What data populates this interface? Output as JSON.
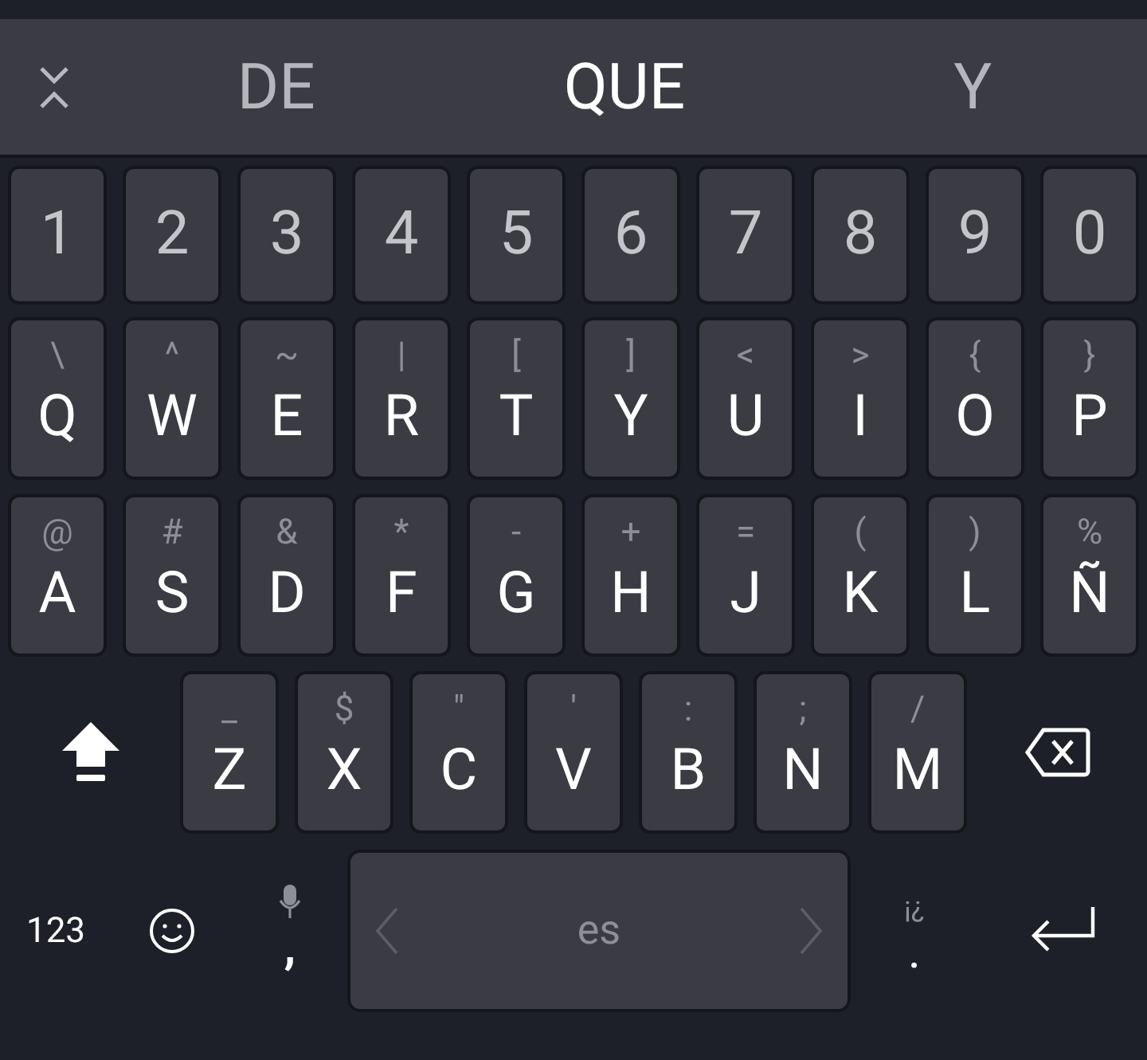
{
  "suggestions": [
    {
      "text": "DE",
      "selected": false
    },
    {
      "text": "QUE",
      "selected": true
    },
    {
      "text": "Y",
      "selected": false
    }
  ],
  "number_row": [
    "1",
    "2",
    "3",
    "4",
    "5",
    "6",
    "7",
    "8",
    "9",
    "0"
  ],
  "letter_rows": [
    [
      {
        "hint": "\\",
        "label": "Q"
      },
      {
        "hint": "^",
        "label": "W"
      },
      {
        "hint": "~",
        "label": "E"
      },
      {
        "hint": "|",
        "label": "R"
      },
      {
        "hint": "[",
        "label": "T"
      },
      {
        "hint": "]",
        "label": "Y"
      },
      {
        "hint": "<",
        "label": "U"
      },
      {
        "hint": ">",
        "label": "I"
      },
      {
        "hint": "{",
        "label": "O"
      },
      {
        "hint": "}",
        "label": "P"
      }
    ],
    [
      {
        "hint": "@",
        "label": "A"
      },
      {
        "hint": "#",
        "label": "S"
      },
      {
        "hint": "&",
        "label": "D"
      },
      {
        "hint": "*",
        "label": "F"
      },
      {
        "hint": "-",
        "label": "G"
      },
      {
        "hint": "+",
        "label": "H"
      },
      {
        "hint": "=",
        "label": "J"
      },
      {
        "hint": "(",
        "label": "K"
      },
      {
        "hint": ")",
        "label": "L"
      },
      {
        "hint": "%",
        "label": "Ñ"
      }
    ],
    [
      {
        "hint": "_",
        "label": "Z"
      },
      {
        "hint": "$",
        "label": "X"
      },
      {
        "hint": "\"",
        "label": "C"
      },
      {
        "hint": "'",
        "label": "V"
      },
      {
        "hint": ":",
        "label": "B"
      },
      {
        "hint": ";",
        "label": "N"
      },
      {
        "hint": "/",
        "label": "M"
      }
    ]
  ],
  "bottom_row": {
    "symbols_key": "123",
    "comma_key": ",",
    "space_label": "es",
    "period_key": ".",
    "period_hint": "¡¿"
  }
}
